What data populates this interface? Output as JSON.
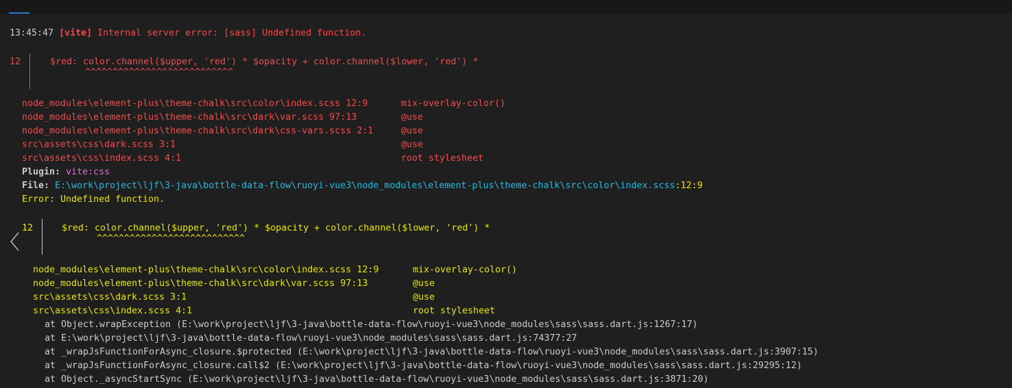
{
  "header": {
    "time": "13:45:47",
    "tag": "[vite]",
    "message": " Internal server error: [sass] Undefined function."
  },
  "snippet1": {
    "line_no": "12",
    "code": "$red: color.channel($upper, 'red') * $opacity + color.channel($lower, 'red') *",
    "carets": "^^^^^^^^^^^^^^^^^^^^^^^^^^^"
  },
  "trace1": [
    {
      "file": "node_modules\\element-plus\\theme-chalk\\src\\color\\index.scss 12:9",
      "member": "mix-overlay-color()"
    },
    {
      "file": "node_modules\\element-plus\\theme-chalk\\src\\dark\\var.scss 97:13",
      "member": "@use"
    },
    {
      "file": "node_modules\\element-plus\\theme-chalk\\src\\dark\\css-vars.scss 2:1",
      "member": "@use"
    },
    {
      "file": "src\\assets\\css\\dark.scss 3:1",
      "member": "@use"
    },
    {
      "file": "src\\assets\\css\\index.scss 4:1",
      "member": "root stylesheet"
    }
  ],
  "plugin": {
    "label": "Plugin:",
    "value": "vite:css"
  },
  "file": {
    "label": "File:",
    "path": "E:\\work\\project\\ljf\\3-java\\bottle-data-flow\\ruoyi-vue3\\node_modules\\element-plus\\theme-chalk\\src\\color\\index.scss",
    "pos": ":12:9"
  },
  "error_line": "Error: Undefined function.",
  "snippet2": {
    "line_no": "12",
    "code": "$red: color.channel($upper, 'red') * $opacity + color.channel($lower, 'red') *",
    "carets": "^^^^^^^^^^^^^^^^^^^^^^^^^^^"
  },
  "trace2": [
    {
      "file": "node_modules\\element-plus\\theme-chalk\\src\\color\\index.scss 12:9",
      "member": "mix-overlay-color()"
    },
    {
      "file": "node_modules\\element-plus\\theme-chalk\\src\\dark\\var.scss 97:13",
      "member": "@use"
    },
    {
      "file": "src\\assets\\css\\dark.scss 3:1",
      "member": "@use"
    },
    {
      "file": "src\\assets\\css\\index.scss 4:1",
      "member": "root stylesheet"
    }
  ],
  "stack": [
    "at Object.wrapException (E:\\work\\project\\ljf\\3-java\\bottle-data-flow\\ruoyi-vue3\\node_modules\\sass\\sass.dart.js:1267:17)",
    "at E:\\work\\project\\ljf\\3-java\\bottle-data-flow\\ruoyi-vue3\\node_modules\\sass\\sass.dart.js:74377:27",
    "at _wrapJsFunctionForAsync_closure.$protected (E:\\work\\project\\ljf\\3-java\\bottle-data-flow\\ruoyi-vue3\\node_modules\\sass\\sass.dart.js:3907:15)",
    "at _wrapJsFunctionForAsync_closure.call$2 (E:\\work\\project\\ljf\\3-java\\bottle-data-flow\\ruoyi-vue3\\node_modules\\sass\\sass.dart.js:29295:12)",
    "at Object._asyncStartSync (E:\\work\\project\\ljf\\3-java\\bottle-data-flow\\ruoyi-vue3\\node_modules\\sass\\sass.dart.js:3871:20)"
  ],
  "colors": {
    "background": "#1f1f1f",
    "error_red": "#f14c4c",
    "warning_yellow": "#e5e510",
    "magenta": "#d670d6",
    "cyan": "#29b8db",
    "text": "#cccccc",
    "tab_accent": "#2b79d6"
  },
  "icons": {
    "collapse": "chevron-left-icon"
  }
}
